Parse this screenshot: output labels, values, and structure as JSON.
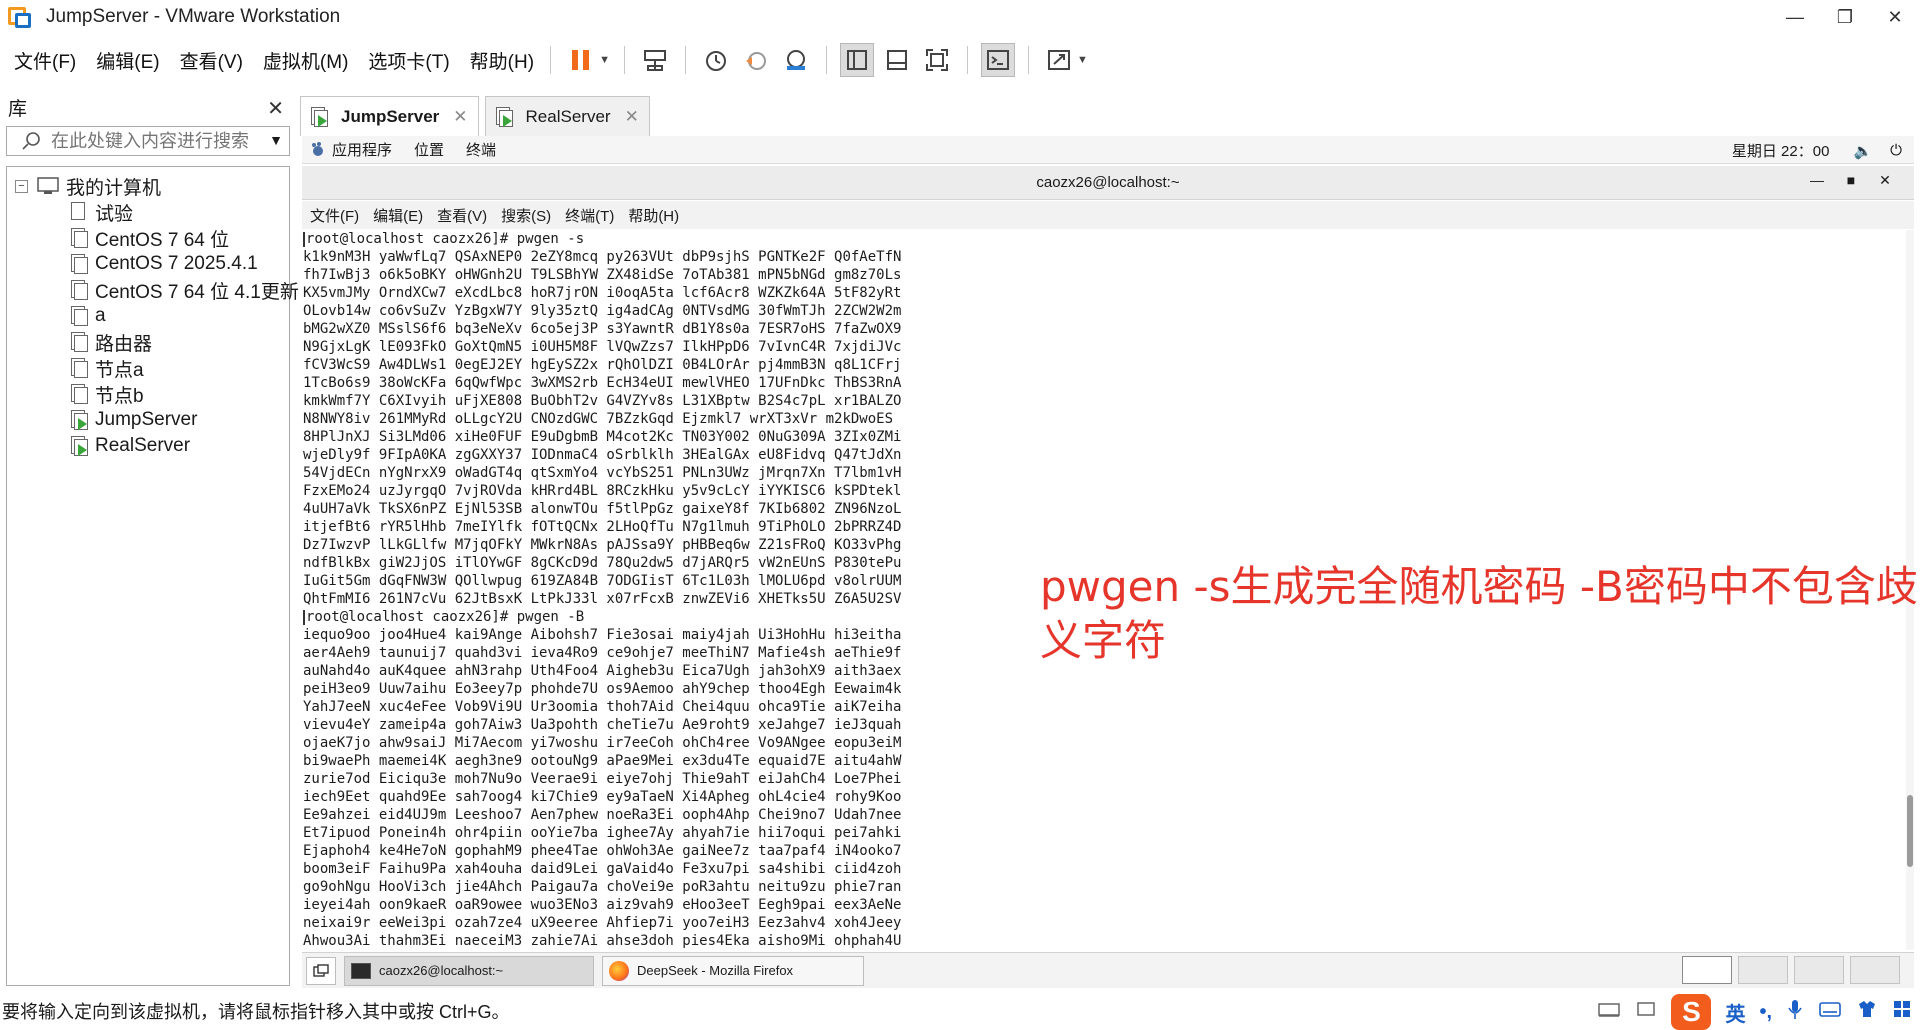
{
  "window": {
    "title": "JumpServer - VMware Workstation"
  },
  "menu": {
    "items": [
      "文件(F)",
      "编辑(E)",
      "查看(V)",
      "虚拟机(M)",
      "选项卡(T)",
      "帮助(H)"
    ]
  },
  "library": {
    "title": "库",
    "search_placeholder": "在此处键入内容进行搜索",
    "root": "我的计算机",
    "items": [
      "试验",
      "CentOS 7 64 位",
      "CentOS 7 2025.4.1",
      "CentOS 7 64 位 4.1更新",
      "a",
      "路由器",
      "节点a",
      "节点b",
      "JumpServer",
      "RealServer"
    ]
  },
  "tabs": [
    {
      "label": "JumpServer",
      "active": true
    },
    {
      "label": "RealServer",
      "active": false
    }
  ],
  "gnome_top": {
    "applications": "应用程序",
    "places": "位置",
    "terminal": "终端",
    "clock": "星期日 22：00"
  },
  "terminal": {
    "title": "caozx26@localhost:~",
    "menu": [
      "文件(F)",
      "编辑(E)",
      "查看(V)",
      "搜索(S)",
      "终端(T)",
      "帮助(H)"
    ],
    "lines": [
      "root@localhost caozx26]# pwgen -s",
      "k1k9nM3H yaWwfLq7 QSAxNEP0 2eZY8mcq py263VUt dbP9sjhS PGNTKe2F Q0fAeTfN",
      "fh7IwBj3 o6k5oBKY oHWGnh2U T9LSBhYW ZX48idSe 7oTAb381 mPN5bNGd gm8z70Ls",
      "KX5vmJMy OrndXCw7 eXcdLbc8 hoR7jrON i0oqA5ta lcf6Acr8 WZKZk64A 5tF82yRt",
      "OLovb14w co6vSuZv YzBgxW7Y 9ly35ztQ ig4adCAg 0NTVsdMG 30fWmTJh 2ZCW2W2m",
      "bMG2wXZ0 MSslS6f6 bq3eNeXv 6co5ej3P s3YawntR dB1Y8s0a 7ESR7oHS 7faZwOX9",
      "N9GjxLgK lE093FkO GoXtQmN5 i0UH5M8F lVQwZzs7 IlkHPpD6 7vIvnC4R 7xjdiJVc",
      "fCV3WcS9 Aw4DLWs1 0egEJ2EY hgEySZ2x rQhOlDZI 0B4LOrAr pj4mmB3N q8L1CFrj",
      "1TcBo6s9 38oWcKFa 6qQwfWpc 3wXMS2rb EcH34eUI mewlVHEO 17UFnDkc ThBS3RnA",
      "kmkWmf7Y C6XIvyih uFjXE808 BuObhT2v G4VZYv8s L31XBptw B2S4c7pL xr1BALZO",
      "N8NWY8iv 261MMyRd oLLgcY2U CNOzdGWC 7BZzkGqd Ejzmkl7 wrXT3xVr m2kDwoES",
      "8HPlJnXJ Si3LMd06 xiHe0FUF E9uDgbmB M4cot2Kc TN03Y002 0NuG309A 3ZIx0ZMi",
      "wjeDly9f 9FIpA0KA zgGXXY37 IODnmaC4 oSrblklh 3HEalGAx eU8Fidvq Q47tJdXn",
      "54VjdECn nYgNrxX9 oWadGT4q qtSxmYo4 vcYbS251 PNLn3UWz jMrqn7Xn T7lbm1vH",
      "FzxEMo24 uzJyrgqO 7vjROVda kHRrd4BL 8RCzkHku y5v9cLcY iYYKISC6 kSPDtekl",
      "4uUH7aVk TkSX6nPZ EjNl53SB alonwTOu f5tlPpGz gaixeY8f 7KIb6802 ZN96NzoL",
      "itjefBt6 rYR5lHhb 7meIYlfk fOTtQCNx 2LHoQfTu N7g1lmuh 9TiPhOLO 2bPRRZ4D",
      "Dz7IwzvP lLkGLlfw M7jqOFkY MWkrN8As pAJSsa9Y pHBBeq6w Z21sFRoQ KO33vPhg",
      "ndfBlkBx giW2JjOS iTlOYwGF 8gCKcD9d 78Qu2dw5 d7jARQr5 vW2nEUnS P830tePu",
      "IuGit5Gm dGqFNW3W QOllwpug 619ZA84B 7ODGIisT 6Tc1L03h lMOLU6pd v8olrUUM",
      "QhtFmMI6 261N7cVu 62JtBsxK LtPkJ33l x07rFcxB znwZEVi6 XHETks5U Z6A5U2SV",
      "root@localhost caozx26]# pwgen -B",
      "iequo9oo joo4Hue4 kai9Ange Aibohsh7 Fie3osai maiy4jah Ui3HohHu hi3eitha",
      "aer4Aeh9 taunuij7 quahd3vi ieva4Ro9 ce9ohje7 meeThiN7 Mafie4sh aeThie9f",
      "auNahd4o auK4quee ahN3rahp Uth4Foo4 Aigheb3u Eica7Ugh jah3ohX9 aith3aex",
      "peiH3eo9 Uuw7aihu Eo3eey7p phohde7U os9Aemoo ahY9chep thoo4Egh Eewaim4k",
      "YahJ7eeN xuc4eFee Vob9Vi9U Ur3oomia thoh7Aid Chei4quu ohca9Tie aiK7eiha",
      "vievu4eY zameip4a goh7Aiw3 Ua3pohth cheTie7u Ae9roht9 xeJahge7 ieJ3quah",
      "ojaeK7jo ahw9saiJ Mi7Aecom yi7woshu ir7eeCoh ohCh4ree Vo9ANgee eopu3eiM",
      "bi9waePh maemei4K aegh3ne9 ootouNg9 aPae9Mei ex3du4Te equaid7E aitu4ahW",
      "zurie7od Eiciqu3e moh7Nu9o Veerae9i eiye7ohj Thie9ahT eiJahCh4 Loe7Phei",
      "iech9Eet quahd9Ee sah7oog4 ki7Chie9 ey9aTaeN Xi4Apheg ohL4cie4 rohy9Koo",
      "Ee9ahzei eid4UJ9m Leeshoo7 Aen7phew noeRa3Ei ooph4Ahp Chei9no7 Udah7nee",
      "Et7ipuod Ponein4h ohr4piin ooYie7ba ighee7Ay ahyah7ie hii7oqui pei7ahki",
      "Ejaphoh4 ke4He7oN gophahM9 phee4Tae ohWoh3Ae gaiNee7z taa7paf4 iN4ooko7",
      "boom3eiF Faihu9Pa xah4ouha daid9Lei gaVaid4o Fe3xu7pi sa4shibi ciid4zoh",
      "go9ohNgu HooVi3ch jie4Ahch Paigau7a choVei9e poR3ahtu neitu9zu phie7ran",
      "ieyei4ah oon9kaeR oaR9owee wuo3ENo3 aiz9vah9 eHoo3eeT Eegh9pai eex3AeNe",
      "neixai9r eeWei3pi ozah7ze4 uX9eeree Ahfiep7i yoo7eiH3 Eez3ahv4 xoh4Jeey",
      "Ahwou3Ai thahm3Ei naeceiM3 zahie7Ai ahse3doh pies4Eka aisho9Mi ohphah4U"
    ]
  },
  "annotation": "pwgen -s生成完全随机密码 -B密码中不包含歧义字符",
  "taskbar": {
    "terminal_task": "caozx26@localhost:~",
    "firefox_task": "DeepSeek - Mozilla Firefox"
  },
  "status": {
    "text": "要将输入定向到该虚拟机，请将鼠标指针移入其中或按 Ctrl+G。",
    "ime_lang": "英",
    "ime_punct": "•,"
  }
}
